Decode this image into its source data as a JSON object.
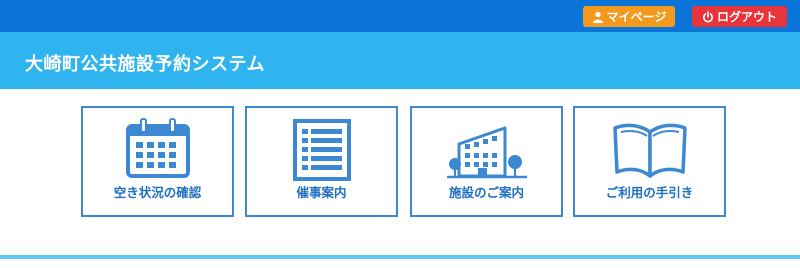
{
  "header": {
    "mypage_label": "マイページ",
    "logout_label": "ログアウト"
  },
  "banner": {
    "title": "大崎町公共施設予約システム"
  },
  "menu": [
    {
      "label": "空き状況の確認",
      "icon": "calendar-icon"
    },
    {
      "label": "催事案内",
      "icon": "list-icon"
    },
    {
      "label": "施設のご案内",
      "icon": "building-icon"
    },
    {
      "label": "ご利用の手引き",
      "icon": "open-book-icon"
    }
  ],
  "colors": {
    "topbar": "#0a74d8",
    "banner": "#30b4f0",
    "mypage": "#f39a1e",
    "logout": "#e8343b",
    "tile_border": "#3c88d2",
    "icon": "#3c88d2"
  }
}
